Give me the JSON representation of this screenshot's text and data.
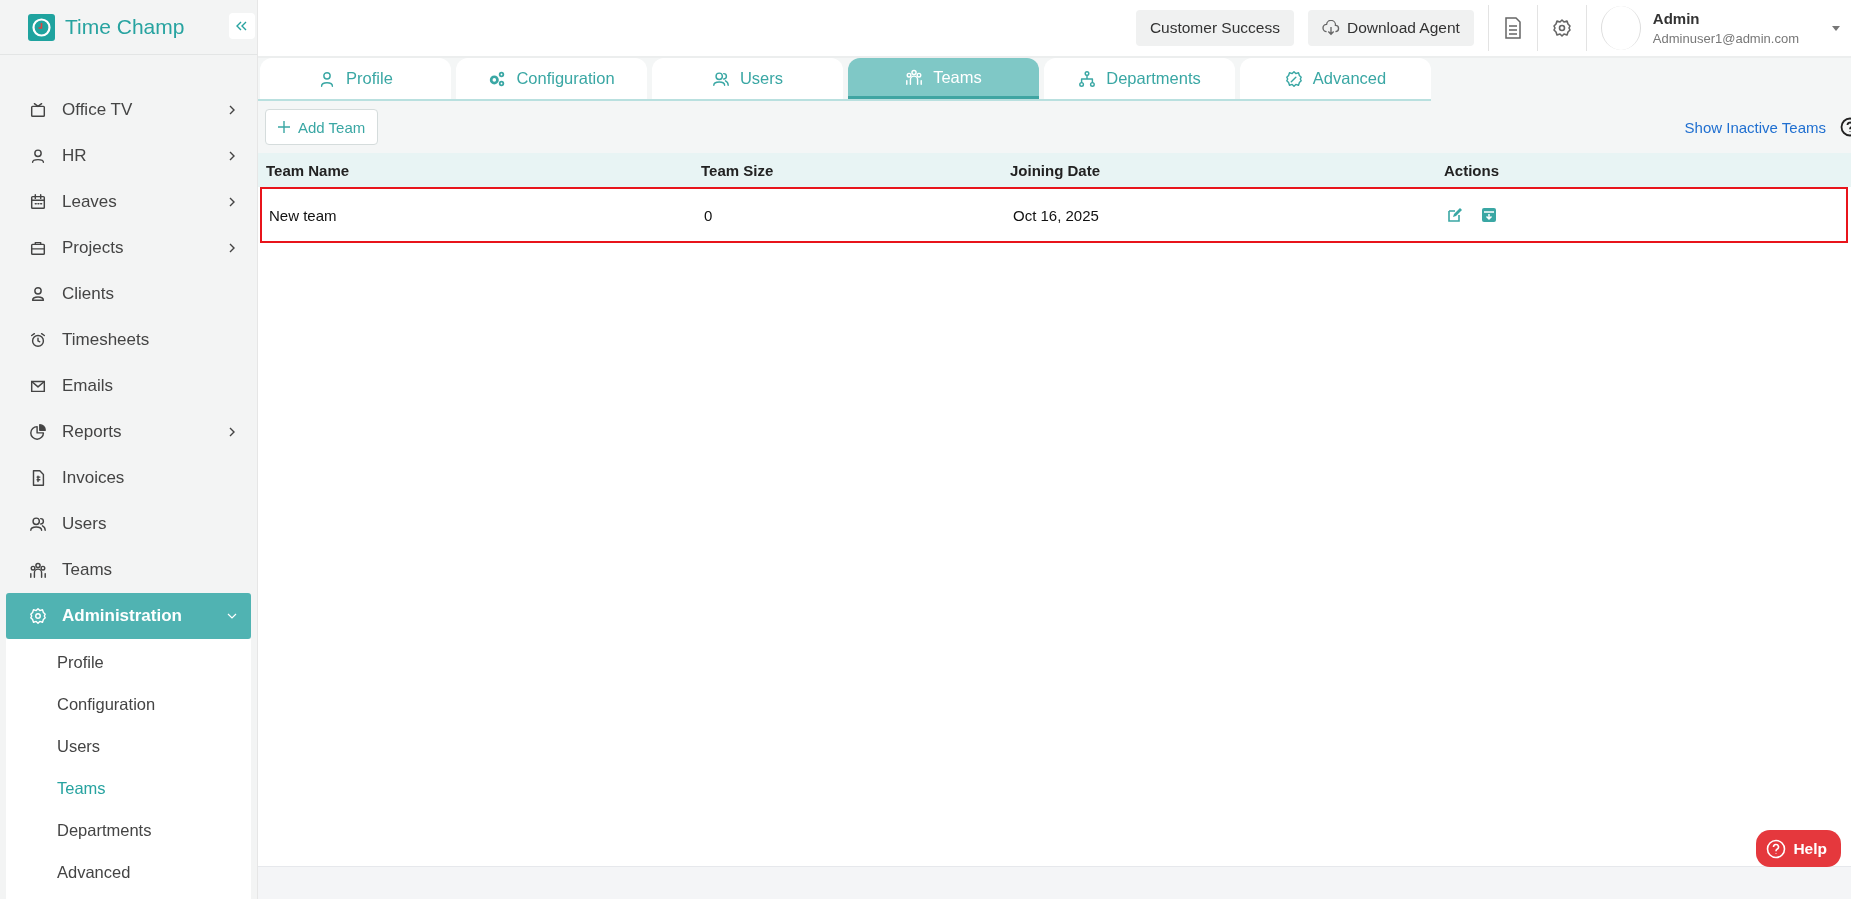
{
  "brand": {
    "name": "Time Champ"
  },
  "sidebar": {
    "items": [
      {
        "label": "Office TV",
        "has_submenu": true,
        "expanded": false,
        "selected": false
      },
      {
        "label": "HR",
        "has_submenu": true,
        "expanded": false,
        "selected": false
      },
      {
        "label": "Leaves",
        "has_submenu": true,
        "expanded": false,
        "selected": false
      },
      {
        "label": "Projects",
        "has_submenu": true,
        "expanded": false,
        "selected": false
      },
      {
        "label": "Clients",
        "has_submenu": false,
        "selected": false
      },
      {
        "label": "Timesheets",
        "has_submenu": false,
        "selected": false
      },
      {
        "label": "Emails",
        "has_submenu": false,
        "selected": false
      },
      {
        "label": "Reports",
        "has_submenu": true,
        "expanded": false,
        "selected": false
      },
      {
        "label": "Invoices",
        "has_submenu": false,
        "selected": false
      },
      {
        "label": "Users",
        "has_submenu": false,
        "selected": false
      },
      {
        "label": "Teams",
        "has_submenu": false,
        "selected": false
      },
      {
        "label": "Administration",
        "has_submenu": true,
        "expanded": true,
        "selected": true,
        "children": [
          {
            "label": "Profile",
            "selected": false
          },
          {
            "label": "Configuration",
            "selected": false
          },
          {
            "label": "Users",
            "selected": false
          },
          {
            "label": "Teams",
            "selected": true
          },
          {
            "label": "Departments",
            "selected": false
          },
          {
            "label": "Advanced",
            "selected": false
          }
        ]
      }
    ]
  },
  "topbar": {
    "buttons": [
      "Customer Success",
      "Download Agent"
    ],
    "user": {
      "name": "Admin",
      "email": "Adminuser1@admin.com"
    }
  },
  "tabs": [
    {
      "label": "Profile",
      "selected": false
    },
    {
      "label": "Configuration",
      "selected": false
    },
    {
      "label": "Users",
      "selected": false
    },
    {
      "label": "Teams",
      "selected": true
    },
    {
      "label": "Departments",
      "selected": false
    },
    {
      "label": "Advanced",
      "selected": false
    }
  ],
  "toolbar": {
    "add_button": "Add Team",
    "link": "Show Inactive Teams"
  },
  "table": {
    "columns": [
      "Team Name",
      "Team Size",
      "Joining Date",
      "Actions"
    ],
    "rows": [
      {
        "cells": [
          "New team",
          "0",
          "Oct 16, 2025"
        ],
        "highlighted": true
      }
    ]
  },
  "help": {
    "label": "Help"
  }
}
